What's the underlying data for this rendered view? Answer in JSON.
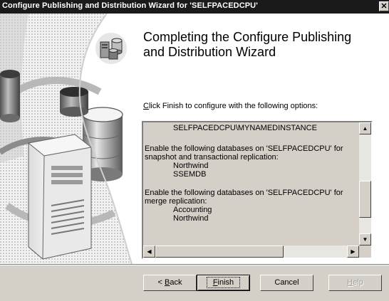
{
  "window": {
    "title": "Configure Publishing and Distribution Wizard for 'SELFPACEDCPU'",
    "close_glyph": "✕"
  },
  "heading": {
    "line1": "Completing the Configure Publishing",
    "line2": "and Distribution Wizard"
  },
  "instruction": {
    "mnemonic": "C",
    "rest": "lick Finish to configure with the following options:"
  },
  "options_box": {
    "lines": [
      "SELFPACEDCPU\\MYNAMEDINSTANCE",
      "Enable the following databases on 'SELFPACEDCPU' for",
      "snapshot and transactional replication:",
      "Northwind",
      "SSEMDB",
      "Enable the following databases on 'SELFPACEDCPU' for",
      "merge replication:",
      "Accounting",
      "Northwind"
    ]
  },
  "scrollbar_glyphs": {
    "up": "▲",
    "down": "▼",
    "left": "◀",
    "right": "▶"
  },
  "buttons": {
    "back_prefix": "< ",
    "back_mnemonic": "B",
    "back_rest": "ack",
    "finish_mnemonic": "F",
    "finish_rest": "inish",
    "cancel": "Cancel",
    "help_mnemonic": "H",
    "help_rest": "elp"
  },
  "icons": {
    "wizard": "server-database-icon",
    "art": "server-databases-illustration"
  },
  "colors": {
    "titlebar": "#1a1a1a",
    "dialog": "#d4d0c8",
    "panel": "#ffffff",
    "options_background": "#d4d0c8"
  }
}
